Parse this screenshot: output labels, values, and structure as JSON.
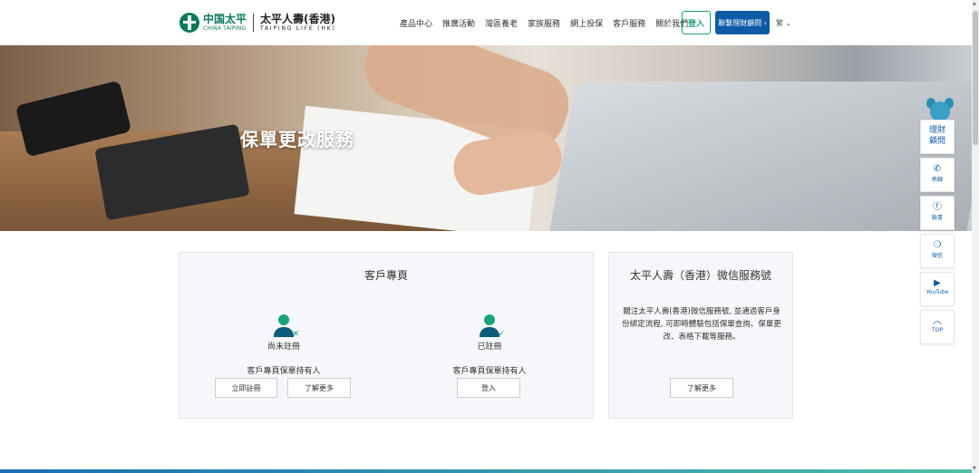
{
  "header": {
    "logo": {
      "cn_name": "中国太平",
      "en_name": "CHINA TAIPING",
      "tp_name": "太平人壽(香港)",
      "tp_en": "TAIPING LIFE (HK)"
    },
    "nav": [
      "產品中心",
      "推廣活動",
      "灣區養老",
      "家族服務",
      "網上投保",
      "客戶服務",
      "關於我們"
    ],
    "login_label": "登入",
    "advisor_label": "聯繫理財顧問 ›",
    "lang_label": "繁 ⌄"
  },
  "hero": {
    "title": "保單更改服務"
  },
  "customer_card": {
    "title": "客戶專頁",
    "unregistered": {
      "status": "尚未註冊",
      "desc": "客戶專頁保單持有人",
      "register_label": "立即註冊",
      "learn_more_label": "了解更多"
    },
    "registered": {
      "status": "已註冊",
      "desc": "客戶專頁保單持有人",
      "signin_label": "登入"
    }
  },
  "wechat_card": {
    "title": "太平人壽（香港）微信服務號",
    "desc": "關注太平人壽(香港)微信服務號, 並通過客戶身份綁定流程, 可即時體驗包括保單查詢、保單更改、表格下載等服務。",
    "learn_more_label": "了解更多"
  },
  "sidebar": {
    "advisor_line1": "理財",
    "advisor_line2": "顧問",
    "hotline": "熱線",
    "facebook": "臉書",
    "wechat": "微信",
    "youtube": "YouTube",
    "top": "TOP"
  },
  "icons": {
    "hotline": "phone-icon",
    "facebook": "facebook-icon",
    "wechat": "wechat-icon",
    "youtube": "youtube-icon",
    "top": "chevron-up-icon"
  },
  "colors": {
    "brand_green": "#1aa37a",
    "brand_blue": "#0d5aa7"
  }
}
